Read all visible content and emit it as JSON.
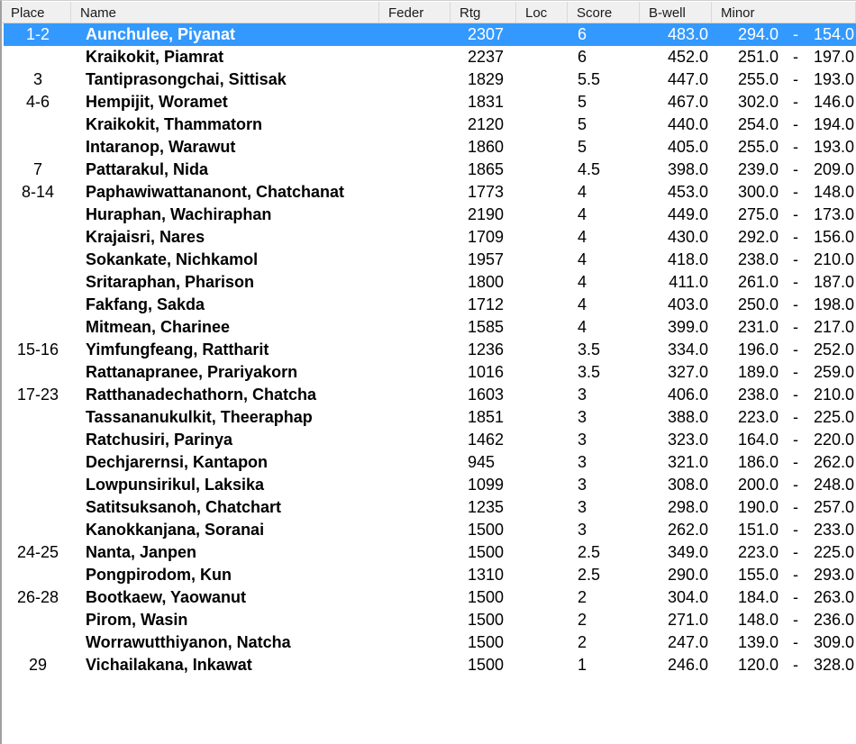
{
  "columns": [
    {
      "key": "place",
      "label": "Place"
    },
    {
      "key": "name",
      "label": "Name"
    },
    {
      "key": "feder",
      "label": "Feder"
    },
    {
      "key": "rtg",
      "label": "Rtg"
    },
    {
      "key": "loc",
      "label": "Loc"
    },
    {
      "key": "score",
      "label": "Score"
    },
    {
      "key": "bwell",
      "label": "B-well"
    },
    {
      "key": "minor",
      "label": "Minor"
    }
  ],
  "selection_color": "#3399FF",
  "selected_row_index": 0,
  "minor_separator": "-",
  "rows": [
    {
      "place": "1-2",
      "name": "Aunchulee, Piyanat",
      "feder": "",
      "rtg": "2307",
      "loc": "",
      "score": "6",
      "bwell": "483.0",
      "minor_a": "294.0",
      "minor_b": "154.0"
    },
    {
      "place": "",
      "name": "Kraikokit, Piamrat",
      "feder": "",
      "rtg": "2237",
      "loc": "",
      "score": "6",
      "bwell": "452.0",
      "minor_a": "251.0",
      "minor_b": "197.0"
    },
    {
      "place": "3",
      "name": "Tantiprasongchai, Sittisak",
      "feder": "",
      "rtg": "1829",
      "loc": "",
      "score": "5.5",
      "bwell": "447.0",
      "minor_a": "255.0",
      "minor_b": "193.0"
    },
    {
      "place": "4-6",
      "name": "Hempijit, Woramet",
      "feder": "",
      "rtg": "1831",
      "loc": "",
      "score": "5",
      "bwell": "467.0",
      "minor_a": "302.0",
      "minor_b": "146.0"
    },
    {
      "place": "",
      "name": "Kraikokit, Thammatorn",
      "feder": "",
      "rtg": "2120",
      "loc": "",
      "score": "5",
      "bwell": "440.0",
      "minor_a": "254.0",
      "minor_b": "194.0"
    },
    {
      "place": "",
      "name": "Intaranop, Warawut",
      "feder": "",
      "rtg": "1860",
      "loc": "",
      "score": "5",
      "bwell": "405.0",
      "minor_a": "255.0",
      "minor_b": "193.0"
    },
    {
      "place": "7",
      "name": "Pattarakul, Nida",
      "feder": "",
      "rtg": "1865",
      "loc": "",
      "score": "4.5",
      "bwell": "398.0",
      "minor_a": "239.0",
      "minor_b": "209.0"
    },
    {
      "place": "8-14",
      "name": "Paphawiwattananont, Chatchanat",
      "feder": "",
      "rtg": "1773",
      "loc": "",
      "score": "4",
      "bwell": "453.0",
      "minor_a": "300.0",
      "minor_b": "148.0"
    },
    {
      "place": "",
      "name": "Huraphan, Wachiraphan",
      "feder": "",
      "rtg": "2190",
      "loc": "",
      "score": "4",
      "bwell": "449.0",
      "minor_a": "275.0",
      "minor_b": "173.0"
    },
    {
      "place": "",
      "name": "Krajaisri, Nares",
      "feder": "",
      "rtg": "1709",
      "loc": "",
      "score": "4",
      "bwell": "430.0",
      "minor_a": "292.0",
      "minor_b": "156.0"
    },
    {
      "place": "",
      "name": "Sokankate, Nichkamol",
      "feder": "",
      "rtg": "1957",
      "loc": "",
      "score": "4",
      "bwell": "418.0",
      "minor_a": "238.0",
      "minor_b": "210.0"
    },
    {
      "place": "",
      "name": "Sritaraphan, Pharison",
      "feder": "",
      "rtg": "1800",
      "loc": "",
      "score": "4",
      "bwell": "411.0",
      "minor_a": "261.0",
      "minor_b": "187.0"
    },
    {
      "place": "",
      "name": "Fakfang, Sakda",
      "feder": "",
      "rtg": "1712",
      "loc": "",
      "score": "4",
      "bwell": "403.0",
      "minor_a": "250.0",
      "minor_b": "198.0"
    },
    {
      "place": "",
      "name": "Mitmean, Charinee",
      "feder": "",
      "rtg": "1585",
      "loc": "",
      "score": "4",
      "bwell": "399.0",
      "minor_a": "231.0",
      "minor_b": "217.0"
    },
    {
      "place": "15-16",
      "name": "Yimfungfeang, Rattharit",
      "feder": "",
      "rtg": "1236",
      "loc": "",
      "score": "3.5",
      "bwell": "334.0",
      "minor_a": "196.0",
      "minor_b": "252.0"
    },
    {
      "place": "",
      "name": "Rattanapranee, Prariyakorn",
      "feder": "",
      "rtg": "1016",
      "loc": "",
      "score": "3.5",
      "bwell": "327.0",
      "minor_a": "189.0",
      "minor_b": "259.0"
    },
    {
      "place": "17-23",
      "name": "Ratthanadechathorn, Chatcha",
      "feder": "",
      "rtg": "1603",
      "loc": "",
      "score": "3",
      "bwell": "406.0",
      "minor_a": "238.0",
      "minor_b": "210.0"
    },
    {
      "place": "",
      "name": "Tassananukulkit, Theeraphap",
      "feder": "",
      "rtg": "1851",
      "loc": "",
      "score": "3",
      "bwell": "388.0",
      "minor_a": "223.0",
      "minor_b": "225.0"
    },
    {
      "place": "",
      "name": "Ratchusiri, Parinya",
      "feder": "",
      "rtg": "1462",
      "loc": "",
      "score": "3",
      "bwell": "323.0",
      "minor_a": "164.0",
      "minor_b": "220.0"
    },
    {
      "place": "",
      "name": "Dechjarernsi, Kantapon",
      "feder": "",
      "rtg": "945",
      "loc": "",
      "score": "3",
      "bwell": "321.0",
      "minor_a": "186.0",
      "minor_b": "262.0"
    },
    {
      "place": "",
      "name": "Lowpunsirikul, Laksika",
      "feder": "",
      "rtg": "1099",
      "loc": "",
      "score": "3",
      "bwell": "308.0",
      "minor_a": "200.0",
      "minor_b": "248.0"
    },
    {
      "place": "",
      "name": "Satitsuksanoh, Chatchart",
      "feder": "",
      "rtg": "1235",
      "loc": "",
      "score": "3",
      "bwell": "298.0",
      "minor_a": "190.0",
      "minor_b": "257.0"
    },
    {
      "place": "",
      "name": "Kanokkanjana, Soranai",
      "feder": "",
      "rtg": "1500",
      "loc": "",
      "score": "3",
      "bwell": "262.0",
      "minor_a": "151.0",
      "minor_b": "233.0"
    },
    {
      "place": "24-25",
      "name": "Nanta, Janpen",
      "feder": "",
      "rtg": "1500",
      "loc": "",
      "score": "2.5",
      "bwell": "349.0",
      "minor_a": "223.0",
      "minor_b": "225.0"
    },
    {
      "place": "",
      "name": "Pongpirodom, Kun",
      "feder": "",
      "rtg": "1310",
      "loc": "",
      "score": "2.5",
      "bwell": "290.0",
      "minor_a": "155.0",
      "minor_b": "293.0"
    },
    {
      "place": "26-28",
      "name": "Bootkaew, Yaowanut",
      "feder": "",
      "rtg": "1500",
      "loc": "",
      "score": "2",
      "bwell": "304.0",
      "minor_a": "184.0",
      "minor_b": "263.0"
    },
    {
      "place": "",
      "name": "Pirom, Wasin",
      "feder": "",
      "rtg": "1500",
      "loc": "",
      "score": "2",
      "bwell": "271.0",
      "minor_a": "148.0",
      "minor_b": "236.0"
    },
    {
      "place": "",
      "name": "Worrawutthiyanon, Natcha",
      "feder": "",
      "rtg": "1500",
      "loc": "",
      "score": "2",
      "bwell": "247.0",
      "minor_a": "139.0",
      "minor_b": "309.0"
    },
    {
      "place": "29",
      "name": "Vichailakana, Inkawat",
      "feder": "",
      "rtg": "1500",
      "loc": "",
      "score": "1",
      "bwell": "246.0",
      "minor_a": "120.0",
      "minor_b": "328.0"
    }
  ]
}
